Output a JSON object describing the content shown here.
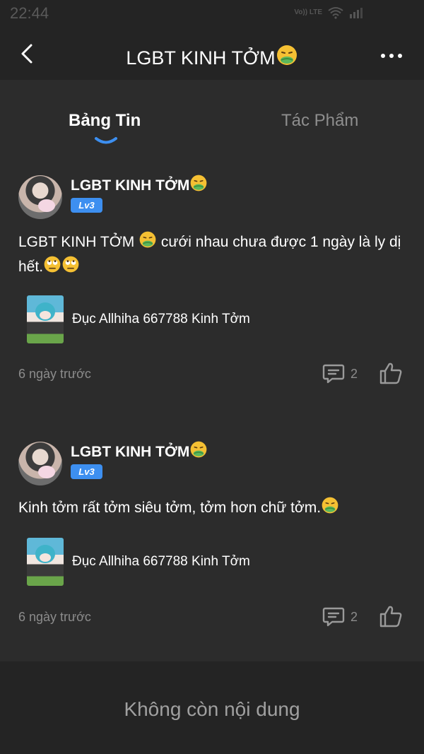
{
  "status_bar": {
    "time": "22:44",
    "network_label": "Vo)) LTE"
  },
  "header": {
    "title": "LGBT KINH TỞM",
    "title_emoji": "nauseated-face-icon"
  },
  "tabs": [
    {
      "label": "Bảng Tin",
      "active": true
    },
    {
      "label": "Tác Phẩm",
      "active": false
    }
  ],
  "posts": [
    {
      "author": "LGBT KINH TỞM",
      "level": "Lv3",
      "content_part1": "LGBT KINH TỞM ",
      "content_part2": " cưới nhau chưa được 1 ngày là ly dị hết.",
      "work_title": "Đục Allhiha 667788 Kinh Tởm",
      "time_ago": "6 ngày trước",
      "comment_count": "2"
    },
    {
      "author": "LGBT KINH TỞM",
      "level": "Lv3",
      "content_part1": "Kinh tởm rất tởm siêu tởm, tởm hơn chữ tởm.",
      "work_title": "Đục Allhiha 667788 Kinh Tởm",
      "time_ago": "6 ngày trước",
      "comment_count": "2"
    }
  ],
  "end_message": "Không còn nội dung",
  "colors": {
    "background": "#2c2c2c",
    "bar": "#242424",
    "accent": "#3d8ff0",
    "muted": "#8c8c8c"
  }
}
